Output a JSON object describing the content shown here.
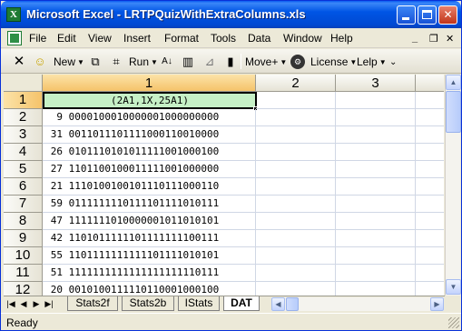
{
  "window": {
    "title": "Microsoft Excel - LRTPQuizWithExtraColumns.xls"
  },
  "menu": {
    "items": [
      "File",
      "Edit",
      "View",
      "Insert",
      "Format",
      "Tools",
      "Data",
      "Window",
      "Help"
    ],
    "mnemonics": [
      "F",
      "E",
      "V",
      "I",
      "o",
      "T",
      "D",
      "W",
      "H"
    ]
  },
  "toolbar": {
    "new_label": "New",
    "run_label": "Run",
    "move_label": "Move+",
    "license_label": "License",
    "lelp_label": "Lelp"
  },
  "grid": {
    "columns": [
      "1",
      "2",
      "3"
    ],
    "active_column": "1",
    "active_row": "1",
    "selected_cell_value": "(2A1,1X,25A1)",
    "rows": [
      {
        "num": "1",
        "id": "",
        "bits": ""
      },
      {
        "num": "2",
        "id": "9",
        "bits": "0000100010000001000000000"
      },
      {
        "num": "3",
        "id": "31",
        "bits": "0011011101111000110010000"
      },
      {
        "num": "4",
        "id": "26",
        "bits": "0101110101011111001000100"
      },
      {
        "num": "5",
        "id": "27",
        "bits": "1101100100011111001000000"
      },
      {
        "num": "6",
        "id": "21",
        "bits": "1110100100101110111000110"
      },
      {
        "num": "7",
        "id": "59",
        "bits": "0111111110111101111010111"
      },
      {
        "num": "8",
        "id": "47",
        "bits": "1111111010000001011010101"
      },
      {
        "num": "9",
        "id": "42",
        "bits": "1101011111101111111100111"
      },
      {
        "num": "10",
        "id": "55",
        "bits": "1101111111111101111010101"
      },
      {
        "num": "11",
        "id": "51",
        "bits": "1111111111111111111110111"
      },
      {
        "num": "12",
        "id": "20",
        "bits": "0010100111110110001000100"
      }
    ]
  },
  "sheets": {
    "tabs": [
      "Stats2f",
      "Stats2b",
      "IStats",
      "DAT"
    ],
    "active": "DAT"
  },
  "status": {
    "text": "Ready"
  }
}
